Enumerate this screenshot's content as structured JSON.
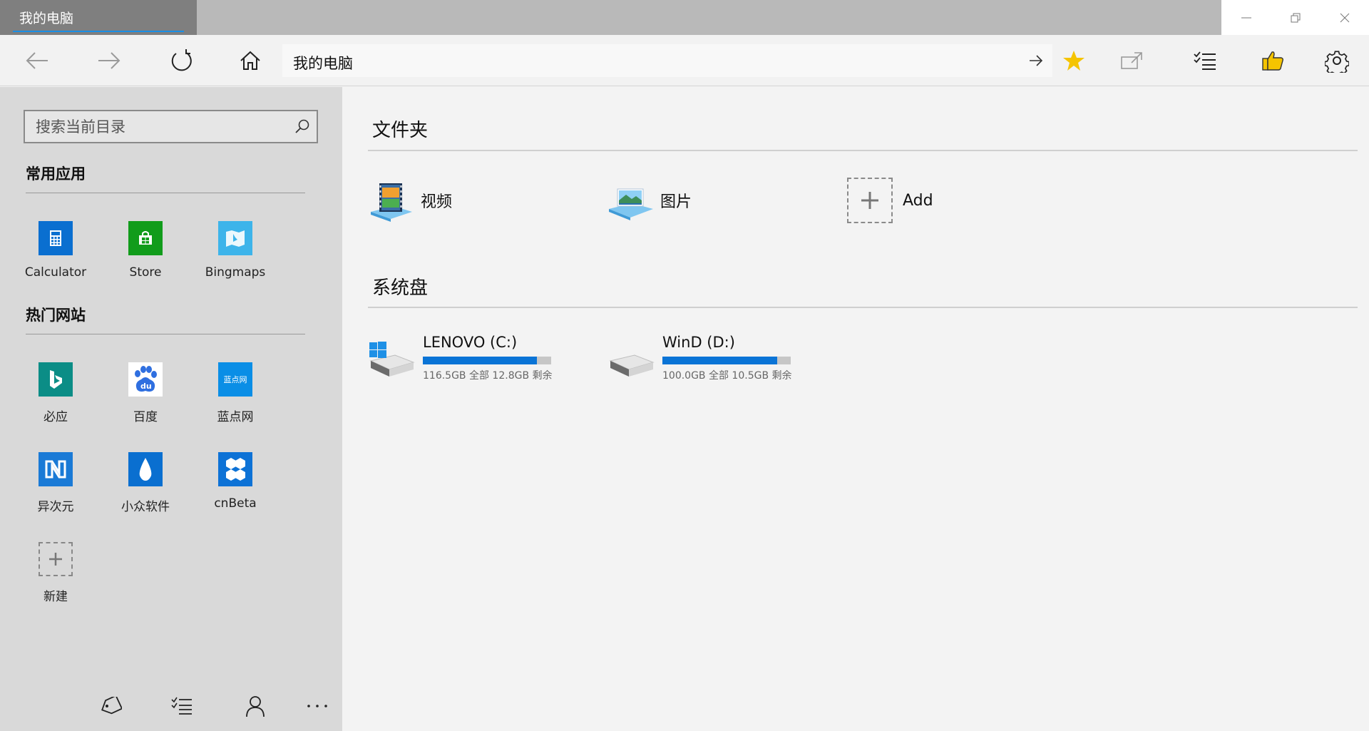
{
  "tab": {
    "title": "我的电脑"
  },
  "toolbar": {
    "address": "我的电脑"
  },
  "sidebar": {
    "search_placeholder": "搜索当前目录",
    "section_apps": "常用应用",
    "section_sites": "热门网站",
    "apps": [
      {
        "label": "Calculator",
        "color": "#0a6fd0"
      },
      {
        "label": "Store",
        "color": "#119c1b"
      },
      {
        "label": "Bingmaps",
        "color": "#3db4ea"
      }
    ],
    "sites": [
      {
        "label": "必应",
        "color": "#0b8d86"
      },
      {
        "label": "百度",
        "color": "#ffffff"
      },
      {
        "label": "蓝点网",
        "color": "#0a8ee6"
      },
      {
        "label": "异次元",
        "color": "#1a7ad6"
      },
      {
        "label": "小众软件",
        "color": "#0a6fd0"
      },
      {
        "label": "cnBeta",
        "color": "#0d72d6"
      },
      {
        "label": "新建",
        "color": "#d9d9d9"
      }
    ],
    "site_logo_text": {
      "lanbook": "蓝点网"
    }
  },
  "main": {
    "section_folders": "文件夹",
    "section_drives": "系统盘",
    "folders": [
      {
        "label": "视频"
      },
      {
        "label": "图片"
      },
      {
        "label": "Add"
      }
    ],
    "drives": [
      {
        "name": "LENOVO (C:)",
        "info": "116.5GB 全部  12.8GB 剩余",
        "used_fraction": 0.89
      },
      {
        "name": "WinD (D:)",
        "info": "100.0GB 全部  10.5GB 剩余",
        "used_fraction": 0.895
      }
    ]
  },
  "colors": {
    "accent": "#0a74d6",
    "star": "#f5c400"
  }
}
